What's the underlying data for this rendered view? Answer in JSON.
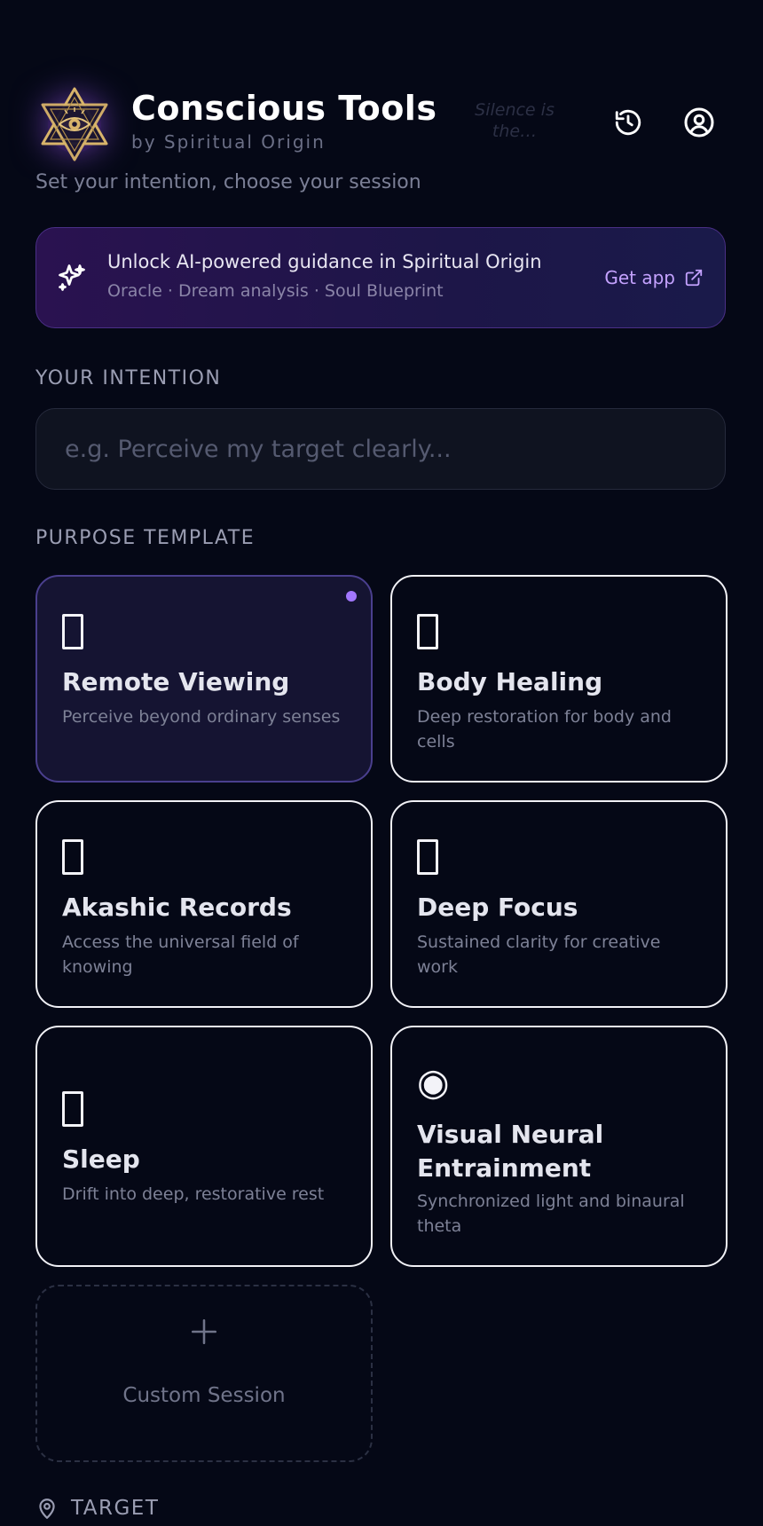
{
  "header": {
    "title": "Conscious Tools",
    "subtitle": "by Spiritual Origin",
    "quote": "Silence is the…",
    "logo_icon": "star-of-david-eye-icon",
    "history_icon": "history-icon",
    "account_icon": "user-circle-icon"
  },
  "tagline": "Set your intention, choose your session",
  "banner": {
    "icon": "sparkles-icon",
    "title": "Unlock AI-powered guidance in Spiritual Origin",
    "subtitle": "Oracle · Dream analysis · Soul Blueprint",
    "cta_label": "Get app",
    "cta_icon": "external-link-icon"
  },
  "intention": {
    "label": "YOUR INTENTION",
    "value": "",
    "placeholder": "e.g. Perceive my target clearly..."
  },
  "purpose": {
    "label": "PURPOSE TEMPLATE",
    "cards": [
      {
        "title": "Remote Viewing",
        "description": "Perceive beyond ordinary senses",
        "selected": true
      },
      {
        "title": "Body Healing",
        "description": "Deep restoration for body and cells",
        "selected": false
      },
      {
        "title": "Akashic Records",
        "description": "Access the universal field of knowing",
        "selected": false
      },
      {
        "title": "Deep Focus",
        "description": "Sustained clarity for creative work",
        "selected": false
      },
      {
        "title": "Sleep",
        "description": "Drift into deep, restorative rest",
        "selected": false
      },
      {
        "title": "Visual Neural Entrainment",
        "description": "Synchronized light and binaural theta",
        "selected": false,
        "icon_glyph": "◉"
      }
    ],
    "custom": {
      "label": "Custom Session",
      "icon": "plus-icon"
    }
  },
  "target": {
    "label": "TARGET",
    "icon": "map-pin-icon"
  },
  "colors": {
    "background": "#050816",
    "accent": "#a277ff",
    "banner_start": "#2a1250",
    "banner_end": "#1a1a4a",
    "logo_gold": "#d8b46a"
  }
}
